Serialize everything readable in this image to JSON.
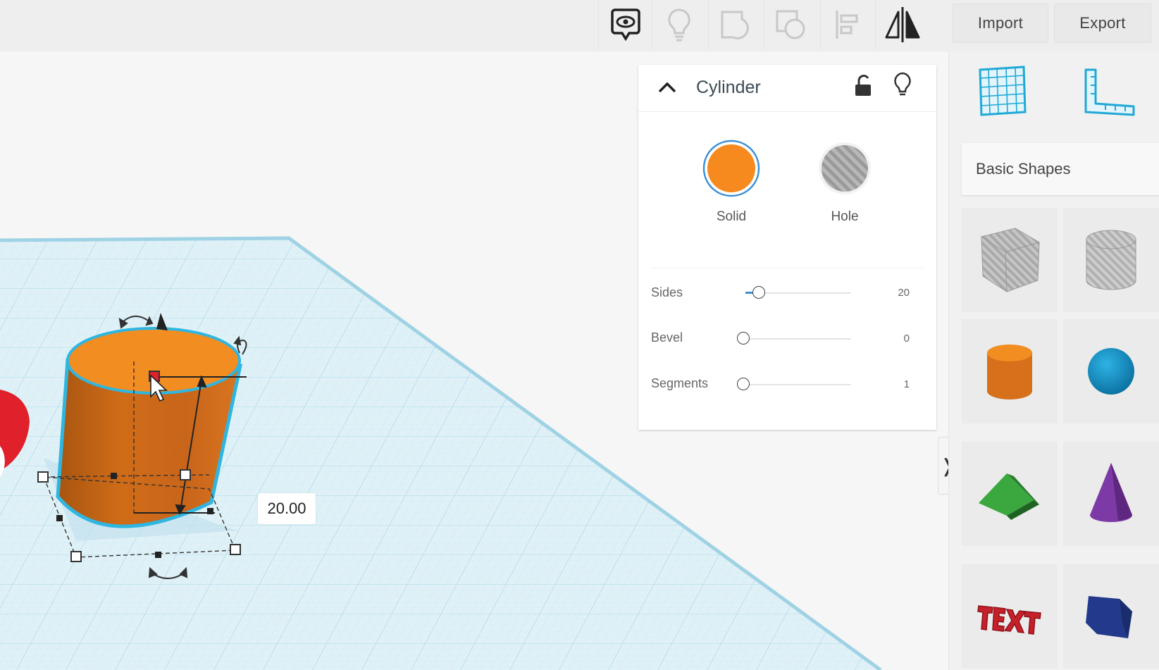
{
  "toolbar": {
    "icons": [
      "notes-icon",
      "lightbulb-icon",
      "group-icon",
      "ungroup-icon",
      "align-icon",
      "mirror-icon"
    ],
    "import_label": "Import",
    "export_label": "Export"
  },
  "inspector": {
    "title": "Cylinder",
    "solid_label": "Solid",
    "hole_label": "Hole",
    "solid_color": "#f68a1f",
    "props": [
      {
        "label": "Sides",
        "value": "20"
      },
      {
        "label": "Bevel",
        "value": "0"
      },
      {
        "label": "Segments",
        "value": "1"
      }
    ]
  },
  "viewport": {
    "dimension_value": "20.00"
  },
  "shapes_panel": {
    "library_label": "Basic Shapes",
    "icons": [
      "workplane-icon",
      "ruler-icon"
    ]
  },
  "colors": {
    "accent": "#1fa9d6",
    "orange": "#f68a1f",
    "grid": "#bfe3ee"
  }
}
